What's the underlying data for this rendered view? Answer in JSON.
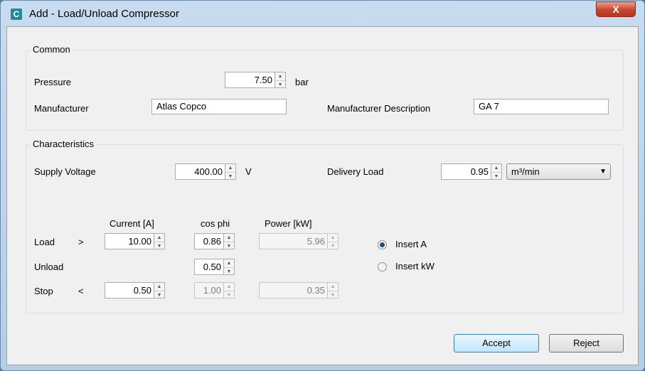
{
  "window": {
    "title": "Add - Load/Unload Compressor",
    "close_label": "X"
  },
  "common": {
    "label": "Common",
    "pressure": {
      "label": "Pressure",
      "value": "7.50",
      "unit": "bar"
    },
    "manufacturer": {
      "label": "Manufacturer",
      "value": "Atlas Copco"
    },
    "manufacturer_description": {
      "label": "Manufacturer Description",
      "value": "GA 7"
    }
  },
  "characteristics": {
    "label": "Characteristics",
    "supply_voltage": {
      "label": "Supply Voltage",
      "value": "400.00",
      "unit": "V"
    },
    "delivery_load": {
      "label": "Delivery Load",
      "value": "0.95",
      "unit_selected": "m³/min"
    },
    "columns": {
      "current": "Current [A]",
      "cos_phi": "cos phi",
      "power": "Power [kW]"
    },
    "load": {
      "label": "Load",
      "symbol": ">",
      "current": "10.00",
      "cos_phi": "0.86",
      "power": "5.96"
    },
    "unload": {
      "label": "Unload",
      "cos_phi": "0.50"
    },
    "stop": {
      "label": "Stop",
      "symbol": "<",
      "current": "0.50",
      "cos_phi": "1.00",
      "power": "0.35"
    },
    "insert_a": {
      "label": "Insert A",
      "checked": true
    },
    "insert_kw": {
      "label": "Insert kW",
      "checked": false
    }
  },
  "buttons": {
    "accept": "Accept",
    "reject": "Reject"
  },
  "icons": {
    "spin_up": "▲",
    "spin_down": "▼",
    "dropdown": "▼",
    "app": "C"
  },
  "colors": {
    "accent": "#1c4f8c",
    "close": "#c8452f"
  }
}
